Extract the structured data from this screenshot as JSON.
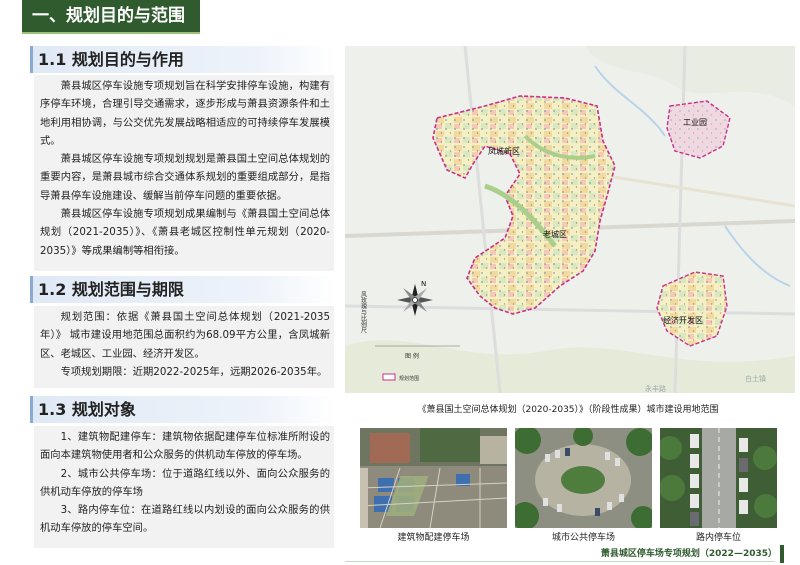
{
  "banner": {
    "title": "一、规划目的与范围"
  },
  "section1": {
    "heading": "1.1 规划目的与作用",
    "paragraphs": [
      "萧县城区停车设施专项规划旨在科学安排停车设施，构建有序停车环境，合理引导交通需求，逐步形成与萧县资源条件和土地利用相协调，与公交优先发展战略相适应的可持续停车发展模式。",
      "萧县城区停车设施专项规划规划是萧县国土空间总体规划的重要内容，是萧县城市综合交通体系规划的重要组成部分，是指导萧县停车设施建设、缓解当前停车问题的重要依据。",
      "萧县城区停车设施专项规划成果编制与《萧县国土空间总体规划（2021-2035）》、《萧县老城区控制性单元规划（2020-2035）》等成果编制等相衔接。"
    ]
  },
  "section2": {
    "heading": "1.2 规划范围与期限",
    "paragraphs": [
      "规划范围：依据《萧县国土空间总体规划（2021-2035年）》 城市建设用地范围总面积约为68.09平方公里，含凤城新区、老城区、工业园、经济开发区。",
      "专项规划期限：近期2022-2025年，远期2026-2035年。"
    ]
  },
  "section3": {
    "heading": "1.3 规划对象",
    "paragraphs": [
      "1、建筑物配建停车：建筑物依据配建停车位标准所附设的面向本建筑物使用者和公众服务的供机动车停放的停车场。",
      "2、城市公共停车场：位于道路红线以外、面向公众服务的供机动车停放的停车场",
      "3、路内停车位：在道路红线以内划设的面向公众服务的供机动车停放的停车空间。"
    ]
  },
  "map": {
    "caption": "《萧县国土空间总体规划（2020-2035）》（阶段性成果）城市建设用地范围",
    "district_labels": [
      "凤城新区",
      "老城区",
      "工业园",
      "经济开发区"
    ],
    "vertical_note": "风玫瑰与比例尺",
    "legend_title": "图  例",
    "legend_item": "规划范围",
    "road_label_1": "永丰路",
    "road_label_2": "白土镇",
    "compass_letter": "N",
    "boundary_color": "#c8308c"
  },
  "photos": [
    {
      "label": "建筑物配建停车场",
      "icon": "building-parking-photo"
    },
    {
      "label": "城市公共停车场",
      "icon": "public-parking-photo"
    },
    {
      "label": "路内停车位",
      "icon": "street-parking-photo"
    }
  ],
  "footer": {
    "title": "萧县城区停车场专项规划（2022—2035）"
  }
}
